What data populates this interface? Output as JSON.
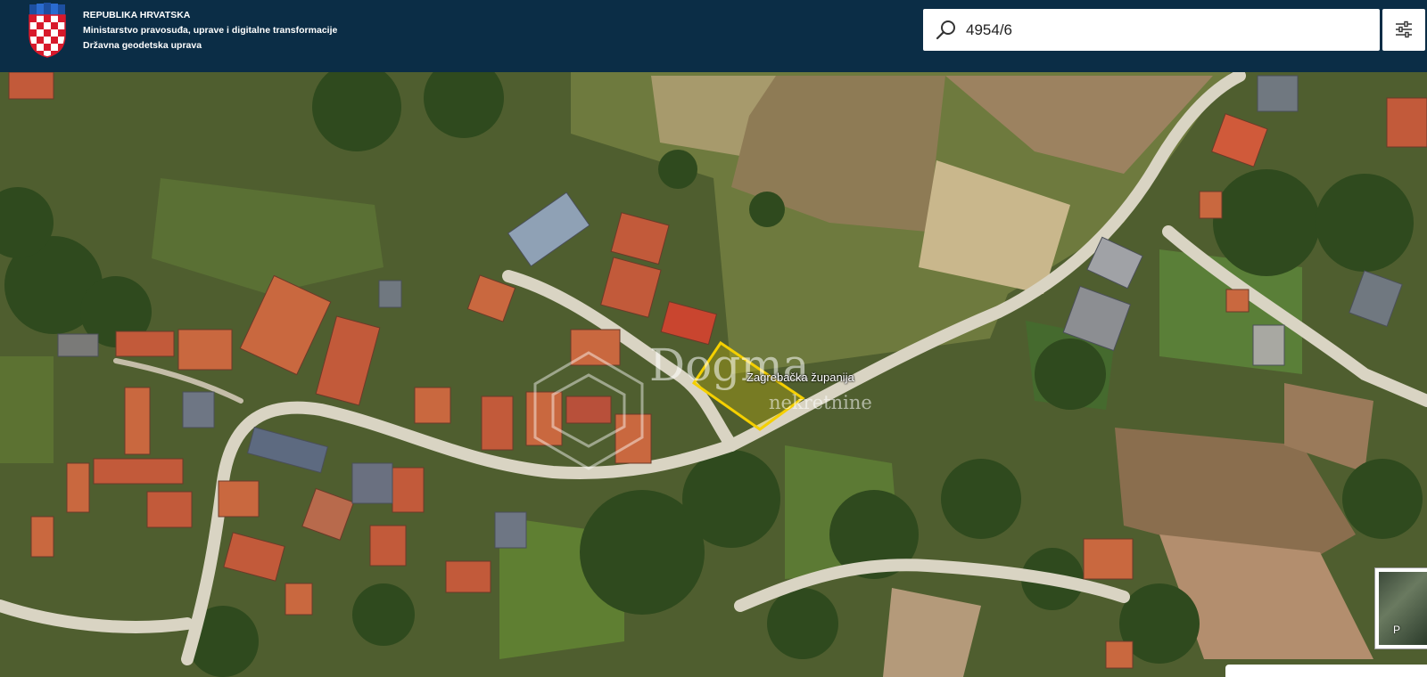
{
  "header": {
    "line1": "REPUBLIKA HRVATSKA",
    "line2": "Ministarstvo pravosuđa, uprave i digitalne transformacije",
    "line3": "Državna geodetska uprava"
  },
  "search": {
    "value": "4954/6"
  },
  "map": {
    "parcel_label": "Zagrebačka županija",
    "watermark_main": "Dogma",
    "watermark_sub": "nekretnine"
  },
  "layer_switcher": {
    "label": "P"
  },
  "colors": {
    "header_bg": "#0b2d46",
    "parcel_outline": "#f5d000"
  },
  "icons": {
    "search": "search-icon",
    "filter": "sliders-icon",
    "coat_of_arms": "coat-of-arms-icon",
    "layers": "layers-icon"
  }
}
